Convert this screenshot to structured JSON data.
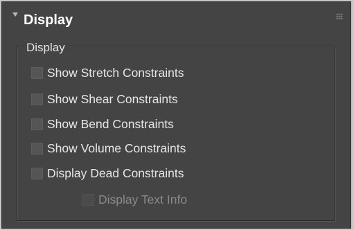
{
  "panel": {
    "title": "Display",
    "group_label": "Display",
    "checkboxes": [
      {
        "label": "Show Stretch Constraints",
        "checked": false,
        "enabled": true
      },
      {
        "label": "Show Shear Constraints",
        "checked": false,
        "enabled": true
      },
      {
        "label": "Show Bend Constraints",
        "checked": false,
        "enabled": true
      },
      {
        "label": "Show Volume Constraints",
        "checked": false,
        "enabled": true
      },
      {
        "label": "Display Dead Constraints",
        "checked": false,
        "enabled": true
      },
      {
        "label": "Display Text Info",
        "checked": false,
        "enabled": false
      }
    ]
  },
  "colors": {
    "panel_background": "#444444",
    "text": "#e6e6e6",
    "disabled_text": "#8a8a8a"
  },
  "icons": [
    "chevron-down-icon",
    "grip-icon"
  ]
}
